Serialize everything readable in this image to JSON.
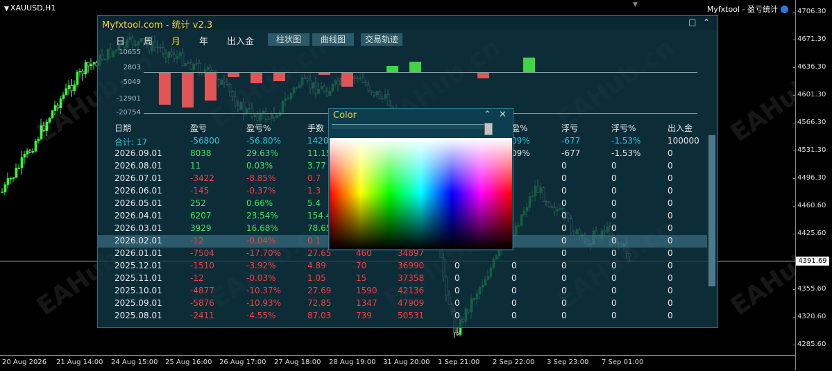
{
  "chart": {
    "symbol": "XAUUSD,H1",
    "ea_label": "Myfxtool - 盈亏统计",
    "current_price": "4391.69",
    "y_ticks": [
      "4706.30",
      "4671.30",
      "4636.30",
      "4601.30",
      "4566.30",
      "4531.30",
      "4496.30",
      "4460.60",
      "4425.60",
      "4391.69",
      "4355.60",
      "4320.60",
      "4285.60"
    ],
    "x_ticks": [
      "20 Aug 2026",
      "21 Aug 14:00",
      "24 Aug 15:00",
      "25 Aug 16:00",
      "26 Aug 17:00",
      "27 Aug 18:00",
      "28 Aug 19:00",
      "31 Aug 20:00",
      "1 Sep 21:00",
      "2 Sep 22:00",
      "3 Sep 23:00",
      "7 Sep 01:00"
    ],
    "watermark": "EAHub.cn"
  },
  "panel": {
    "title": "Myfxtool.com - 统计  v2.3",
    "minimize_icon": "□",
    "collapse_icon": "⌃",
    "nav": [
      "日",
      "周",
      "月",
      "年",
      "出入金"
    ],
    "active_nav": "月",
    "buttons": [
      "柱状图",
      "曲线图",
      "交易轨迹"
    ],
    "bar_axis_labels": [
      "10655",
      "2803",
      "-5049",
      "-12901",
      "-20754"
    ],
    "bars": [
      {
        "type": "neg",
        "value": -12
      },
      {
        "type": "neg",
        "value": -7504
      },
      {
        "type": "neg",
        "value": -1510
      },
      {
        "type": "neg",
        "value": -12
      },
      {
        "type": "neg",
        "value": -4877
      },
      {
        "type": "neg",
        "value": -5876
      },
      {
        "type": "neg",
        "value": -2411
      }
    ],
    "headers": [
      "日期",
      "盈亏",
      "盈亏%",
      "手数",
      "",
      "",
      "",
      "盈%",
      "浮亏",
      "浮亏%",
      "出入金"
    ],
    "rows": [
      {
        "cells": [
          "合计: 17",
          "-56800",
          "-56.80%",
          "1420.",
          "",
          "",
          "",
          "09%",
          "-677",
          "-1.53%",
          "100000"
        ],
        "colors": [
          "teal",
          "teal",
          "teal",
          "teal",
          "",
          "",
          "",
          "teal",
          "teal",
          "teal",
          "white"
        ]
      },
      {
        "cells": [
          "2026.09.01",
          "8038",
          "29.63%",
          "11.15",
          "",
          "",
          "",
          "09%",
          "-677",
          "-1.53%",
          "0"
        ],
        "colors": [
          "date",
          "green",
          "green",
          "green",
          "",
          "",
          "",
          "white",
          "white",
          "white",
          "white"
        ]
      },
      {
        "cells": [
          "2026.08.01",
          "11",
          "0.03%",
          "3.77",
          "",
          "",
          "",
          "",
          "0",
          "0",
          "0"
        ],
        "colors": [
          "date",
          "green",
          "green",
          "green",
          "",
          "",
          "",
          "",
          "white",
          "white",
          "white"
        ]
      },
      {
        "cells": [
          "2026.07.01",
          "-3422",
          "-8.85%",
          "0.7",
          "",
          "",
          "",
          "",
          "0",
          "0",
          "0"
        ],
        "colors": [
          "date",
          "red",
          "red",
          "red",
          "",
          "",
          "",
          "",
          "white",
          "white",
          "white"
        ]
      },
      {
        "cells": [
          "2026.06.01",
          "-145",
          "-0.37%",
          "1.3",
          "",
          "",
          "",
          "",
          "0",
          "0",
          "0"
        ],
        "colors": [
          "date",
          "red",
          "red",
          "red",
          "",
          "",
          "",
          "",
          "white",
          "white",
          "white"
        ]
      },
      {
        "cells": [
          "2026.05.01",
          "252",
          "0.66%",
          "5.4",
          "",
          "",
          "",
          "",
          "0",
          "0",
          "0"
        ],
        "colors": [
          "date",
          "green",
          "green",
          "green",
          "",
          "",
          "",
          "",
          "white",
          "white",
          "white"
        ]
      },
      {
        "cells": [
          "2026.04.01",
          "6207",
          "23.54%",
          "154.4",
          "",
          "",
          "",
          "",
          "0",
          "0",
          "0"
        ],
        "colors": [
          "date",
          "green",
          "green",
          "green",
          "",
          "",
          "",
          "",
          "white",
          "white",
          "white"
        ]
      },
      {
        "cells": [
          "2026.03.01",
          "3929",
          "16.68%",
          "78.65",
          "",
          "",
          "",
          "",
          "0",
          "0",
          "0"
        ],
        "colors": [
          "date",
          "green",
          "green",
          "green",
          "",
          "",
          "",
          "",
          "white",
          "white",
          "white"
        ]
      },
      {
        "cells": [
          "2026.02.01",
          "-12",
          "-0.04%",
          "0.1",
          "",
          "",
          "",
          "",
          "0",
          "0",
          "0"
        ],
        "colors": [
          "date",
          "red",
          "red",
          "red",
          "",
          "",
          "",
          "",
          "white",
          "white",
          "white"
        ]
      },
      {
        "cells": [
          "2026.01.01",
          "-7504",
          "-17.70%",
          "27.65",
          "460",
          "34897",
          "",
          "",
          "0",
          "0",
          "0"
        ],
        "colors": [
          "date",
          "red",
          "red",
          "red",
          "red",
          "red",
          "",
          "",
          "white",
          "white",
          "white"
        ]
      },
      {
        "cells": [
          "2025.12.01",
          "-1510",
          "-3.92%",
          "4.89",
          "70",
          "36990",
          "0",
          "0",
          "0",
          "0",
          "0"
        ],
        "colors": [
          "date",
          "red",
          "red",
          "red",
          "red",
          "red",
          "white",
          "white",
          "white",
          "white",
          "white"
        ]
      },
      {
        "cells": [
          "2025.11.01",
          "-12",
          "-0.03%",
          "1.05",
          "15",
          "37358",
          "0",
          "0",
          "0",
          "0",
          "0"
        ],
        "colors": [
          "date",
          "red",
          "red",
          "red",
          "red",
          "red",
          "white",
          "white",
          "white",
          "white",
          "white"
        ]
      },
      {
        "cells": [
          "2025.10.01",
          "-4877",
          "-10.37%",
          "27.69",
          "1590",
          "42136",
          "0",
          "0",
          "0",
          "0",
          "0"
        ],
        "colors": [
          "date",
          "red",
          "red",
          "red",
          "red",
          "red",
          "white",
          "white",
          "white",
          "white",
          "white"
        ]
      },
      {
        "cells": [
          "2025.09.01",
          "-5876",
          "-10.93%",
          "72.85",
          "1347",
          "47909",
          "0",
          "0",
          "0",
          "0",
          "0"
        ],
        "colors": [
          "date",
          "red",
          "red",
          "red",
          "red",
          "red",
          "white",
          "white",
          "white",
          "white",
          "white"
        ]
      },
      {
        "cells": [
          "2025.08.01",
          "-2411",
          "-4.55%",
          "87.03",
          "739",
          "50531",
          "0",
          "0",
          "0",
          "0",
          "0"
        ],
        "colors": [
          "date",
          "red",
          "red",
          "red",
          "red",
          "red",
          "white",
          "white",
          "white",
          "white",
          "white"
        ]
      }
    ],
    "highlighted_row": 8
  },
  "color_picker": {
    "title": "Color",
    "collapse_icon": "⌃",
    "close_icon": "✕"
  }
}
